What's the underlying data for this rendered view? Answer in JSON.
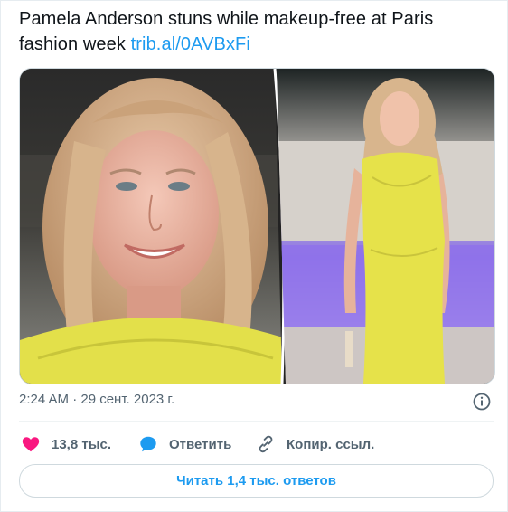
{
  "tweet": {
    "text": "Pamela Anderson stuns while makeup-free at Paris fashion week",
    "link": "trib.al/0AVBxFi"
  },
  "timestamp": "2:24 AM · 29 сент. 2023 г.",
  "actions": {
    "likes": "13,8 тыс.",
    "reply": "Ответить",
    "copy_link": "Копир. ссыл."
  },
  "read_replies": "Читать 1,4 тыс. ответов",
  "colors": {
    "accent": "#1d9bf0",
    "like": "#f91880",
    "muted": "#536471",
    "dress": "#e6e24a"
  },
  "icons": {
    "like": "heart-icon",
    "reply": "speech-bubble-icon",
    "copy": "link-icon",
    "info": "info-icon"
  }
}
